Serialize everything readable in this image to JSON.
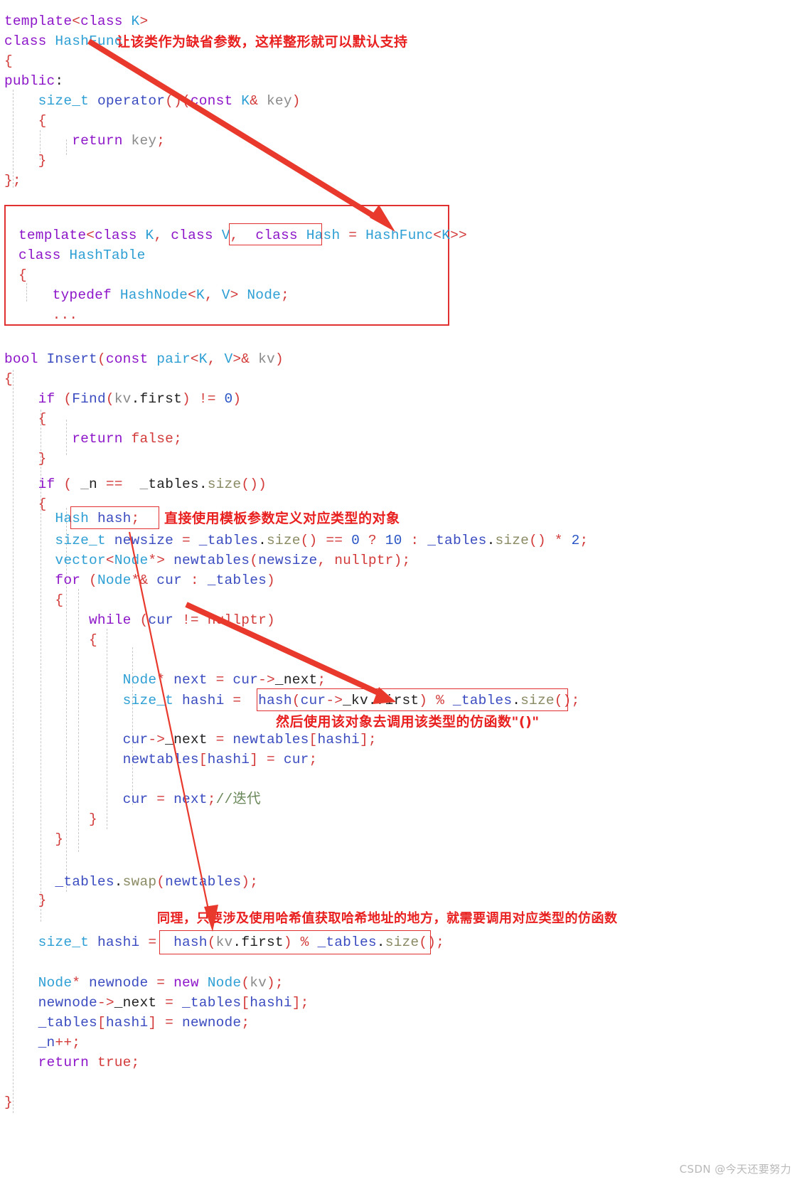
{
  "colors": {
    "annotation_red": "#e8201f",
    "box_red": "#e03030",
    "arrow_red": "#e8392c",
    "keyword_purple": "#8d16c9",
    "type_blue": "#2e9fd4",
    "identifier_blue": "#3b4cc0",
    "punctuation_red": "#d33a3a",
    "watermark_grey": "#b9b9b9",
    "background": "#ffffff"
  },
  "code_block_1": {
    "lines": [
      "template<class K>",
      "class HashFunc",
      "{",
      "public:",
      "    size_t operator()(const K& key)",
      "    {",
      "        return key;",
      "    }",
      "};"
    ]
  },
  "code_block_2": {
    "boxed": true,
    "lines": [
      "template<class K, class V, class Hash = HashFunc<K>>",
      "class HashTable",
      "{",
      "    typedef HashNode<K, V> Node;",
      "    ..."
    ],
    "inner_highlight": "class Hash"
  },
  "code_block_3": {
    "lines": [
      "bool Insert(const pair<K, V>& kv)",
      "{",
      "    if (Find(kv.first) != 0)",
      "    {",
      "        return false;",
      "    }",
      "    if ( _n ==  _tables.size())",
      "    {",
      "        Hash hash;",
      "        size_t newsize = _tables.size() == 0 ? 10 : _tables.size() * 2;",
      "        vector<Node*> newtables(newsize, nullptr);",
      "        for (Node*& cur : _tables)",
      "        {",
      "            while (cur != nullptr)",
      "            {",
      "",
      "                Node* next = cur->_next;",
      "                size_t hashi = hash(cur->_kv.first) % _tables.size();",
      "",
      "                cur->_next = newtables[hashi];",
      "                newtables[hashi] = cur;",
      "",
      "                cur = next;//迭代",
      "            }",
      "        }",
      "",
      "        _tables.swap(newtables);",
      "    }",
      "    size_t hashi = hash(kv.first) % _tables.size();",
      "",
      "    Node* newnode = new Node(kv);",
      "    newnode->_next = _tables[hashi];",
      "    _tables[hashi] = newnode;",
      "    _n++;",
      "    return true;",
      "",
      "",
      "}"
    ],
    "highlights": [
      "Hash hash;",
      "hash(cur->_kv.first) % _tables.size();",
      "hash(kv.first) % _tables.size();"
    ]
  },
  "annotations": [
    {
      "id": "annot-default-param",
      "text": "让该类作为缺省参数，这样整形就可以默认支持"
    },
    {
      "id": "annot-template-object",
      "text": "直接使用模板参数定义对应类型的对象"
    },
    {
      "id": "annot-call-functor",
      "text": "然后使用该对象去调用该类型的仿函数\"()\""
    },
    {
      "id": "annot-same-reason",
      "text": "同理，只要涉及使用哈希值获取哈希地址的地方，就需要调用对应类型的仿函数"
    }
  ],
  "watermark": {
    "text": "CSDN @今天还要努力"
  }
}
